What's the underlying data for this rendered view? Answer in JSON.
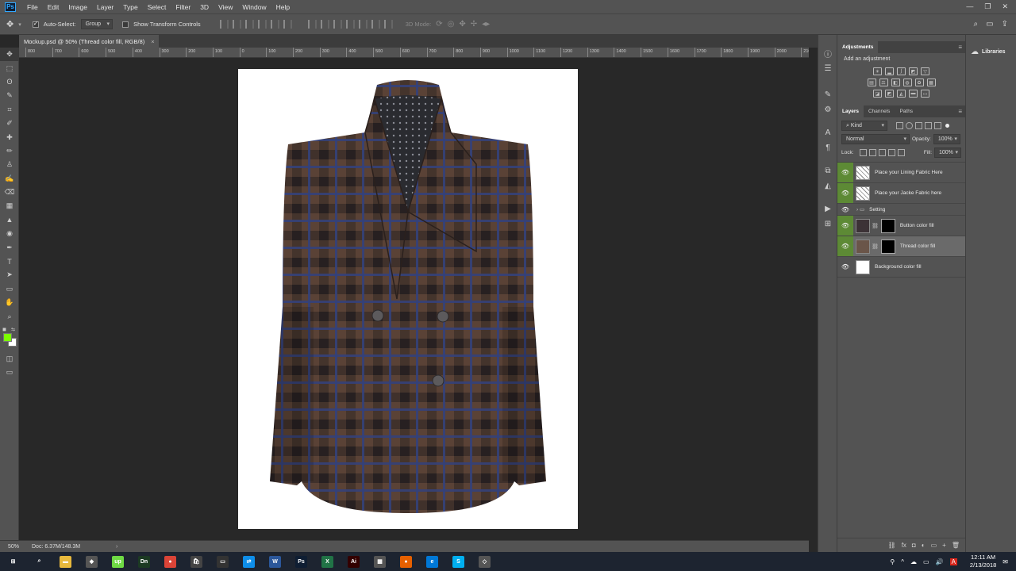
{
  "app": {
    "logo_text": "Ps",
    "win_controls": [
      "—",
      "❐",
      "✕"
    ]
  },
  "menu": [
    "File",
    "Edit",
    "Image",
    "Layer",
    "Type",
    "Select",
    "Filter",
    "3D",
    "View",
    "Window",
    "Help"
  ],
  "options": {
    "auto_select_label": "Auto-Select:",
    "auto_select_value": "Group",
    "transform_label": "Show Transform Controls",
    "mode_3d_label": "3D Mode:"
  },
  "document": {
    "tab_title": "Mockup.psd @ 50% (Thread color fill, RGB/8)",
    "tab_close": "×",
    "zoom": "50%",
    "doc_info": "Doc: 6.37M/148.3M",
    "status_arrow": "›"
  },
  "ruler_labels": [
    "800",
    "700",
    "600",
    "500",
    "400",
    "300",
    "200",
    "100",
    "0",
    "100",
    "200",
    "300",
    "400",
    "500",
    "600",
    "700",
    "800",
    "900",
    "1000",
    "1100",
    "1200",
    "1300",
    "1400",
    "1500",
    "1600",
    "1700",
    "1800",
    "1900",
    "2000",
    "2100"
  ],
  "tools": [
    "move-tool",
    "marquee-tool",
    "lasso-tool",
    "quick-select-tool",
    "crop-tool",
    "eyedropper-tool",
    "healing-tool",
    "brush-tool",
    "stamp-tool",
    "history-brush-tool",
    "eraser-tool",
    "gradient-tool",
    "blur-tool",
    "dodge-tool",
    "pen-tool",
    "type-tool",
    "path-select-tool",
    "shape-tool",
    "hand-tool",
    "zoom-tool"
  ],
  "tool_glyphs": [
    "✥",
    "⬚",
    "ʘ",
    "✎",
    "⌗",
    "✐",
    "✚",
    "✏",
    "♙",
    "✍",
    "⌫",
    "▦",
    "▲",
    "◉",
    "✒",
    "T",
    "➤",
    "▭",
    "✋",
    "⌕"
  ],
  "colors": {
    "foreground": "#7cfc00",
    "background": "#ffffff",
    "accent_green": "#5d8a35"
  },
  "adjustments": {
    "tab_label": "Adjustments",
    "menu": "≡",
    "title": "Add an adjustment"
  },
  "layers_panel": {
    "tabs": [
      "Layers",
      "Channels",
      "Paths"
    ],
    "menu": "≡",
    "filter_label": "⌕ Kind",
    "blend_mode": "Normal",
    "opacity_label": "Opacity:",
    "opacity_value": "100%",
    "lock_label": "Lock:",
    "fill_label": "Fill:",
    "fill_value": "100%",
    "eye_glyph": "👁",
    "chain_glyph": "⛓",
    "group_glyph": "› ▭",
    "layers": [
      {
        "name": "Place your Lining Fabric Here",
        "type": "smart",
        "visible_green": true
      },
      {
        "name": "Place your Jacke Fabric here",
        "type": "smart",
        "visible_green": true
      },
      {
        "name": "Setting",
        "type": "group",
        "visible_green": false
      },
      {
        "name": "Button color fill",
        "type": "fill-dark",
        "visible_green": true
      },
      {
        "name": "Thread color fill",
        "type": "fill-brown",
        "visible_green": true,
        "selected": true
      },
      {
        "name": "Background color fill",
        "type": "fill-white",
        "visible_green": false
      }
    ],
    "bottom_icons": [
      "⛓",
      "fx",
      "◘",
      "◐",
      "▭",
      "+",
      "🗑"
    ]
  },
  "libraries": {
    "label": "Libraries",
    "glyph": "☁"
  },
  "taskbar": {
    "apps": [
      {
        "name": "start-icon",
        "label": "⊞",
        "color": "#1d2430"
      },
      {
        "name": "search-icon",
        "label": "⌕",
        "color": "#1d2430"
      },
      {
        "name": "file-explorer-icon",
        "label": "▬",
        "color": "#e8b93d"
      },
      {
        "name": "app-icon",
        "label": "◆",
        "color": "#555"
      },
      {
        "name": "upwork-icon",
        "label": "up",
        "color": "#6fda44"
      },
      {
        "name": "dreamweaver-icon",
        "label": "Dn",
        "color": "#1c3a23"
      },
      {
        "name": "chrome-icon",
        "label": "●",
        "color": "#db4437"
      },
      {
        "name": "store-icon",
        "label": "🛍",
        "color": "#444"
      },
      {
        "name": "terminal-icon",
        "label": "▭",
        "color": "#333"
      },
      {
        "name": "teamviewer-icon",
        "label": "⇄",
        "color": "#0e8ee9"
      },
      {
        "name": "word-icon",
        "label": "W",
        "color": "#2b579a"
      },
      {
        "name": "photoshop-icon",
        "label": "Ps",
        "color": "#0f1e33"
      },
      {
        "name": "excel-icon",
        "label": "X",
        "color": "#217346"
      },
      {
        "name": "illustrator-icon",
        "label": "Ai",
        "color": "#330000"
      },
      {
        "name": "calculator-icon",
        "label": "▦",
        "color": "#555"
      },
      {
        "name": "firefox-icon",
        "label": "●",
        "color": "#e66000"
      },
      {
        "name": "edge-icon",
        "label": "e",
        "color": "#0078d7"
      },
      {
        "name": "skype-icon",
        "label": "S",
        "color": "#00aff0"
      },
      {
        "name": "app2-icon",
        "label": "◇",
        "color": "#555"
      }
    ],
    "time": "12:11 AM",
    "date": "2/13/2018",
    "tray_glyphs": [
      "⚲",
      "^",
      "☁",
      "▭",
      "🔊",
      "A",
      "✉"
    ]
  }
}
